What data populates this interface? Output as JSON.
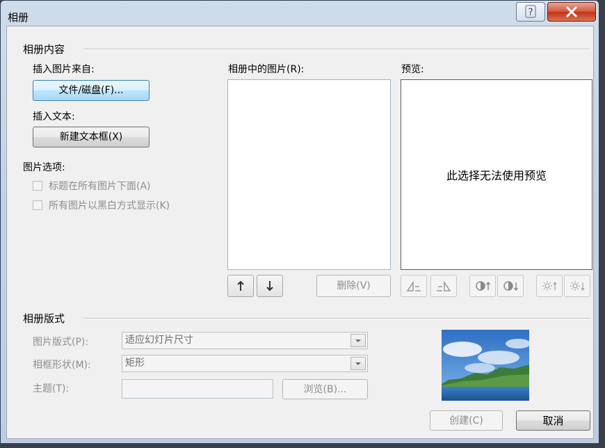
{
  "window": {
    "title": "相册"
  },
  "content_group": {
    "label": "相册内容",
    "insert_picture_label": "插入图片来自:",
    "file_disk_button": "文件/磁盘(F)...",
    "insert_text_label": "插入文本:",
    "new_textbox_button": "新建文本框(X)",
    "picture_options_label": "图片选项:",
    "captions_below_all": "标题在所有图片下面(A)",
    "all_black_white": "所有图片以黑白方式显示(K)",
    "pictures_in_album_label": "相册中的图片(R):",
    "remove_button": "删除(V)",
    "preview_label": "预览:",
    "preview_unavailable": "此选择无法使用预览"
  },
  "layout_group": {
    "label": "相册版式",
    "picture_layout_label": "图片版式(P):",
    "picture_layout_value": "适应幻灯片尺寸",
    "frame_shape_label": "相框形状(M):",
    "frame_shape_value": "矩形",
    "theme_label": "主题(T):",
    "browse_button": "浏览(B)..."
  },
  "footer": {
    "create_button": "创建(C)",
    "cancel_button": "取消"
  }
}
